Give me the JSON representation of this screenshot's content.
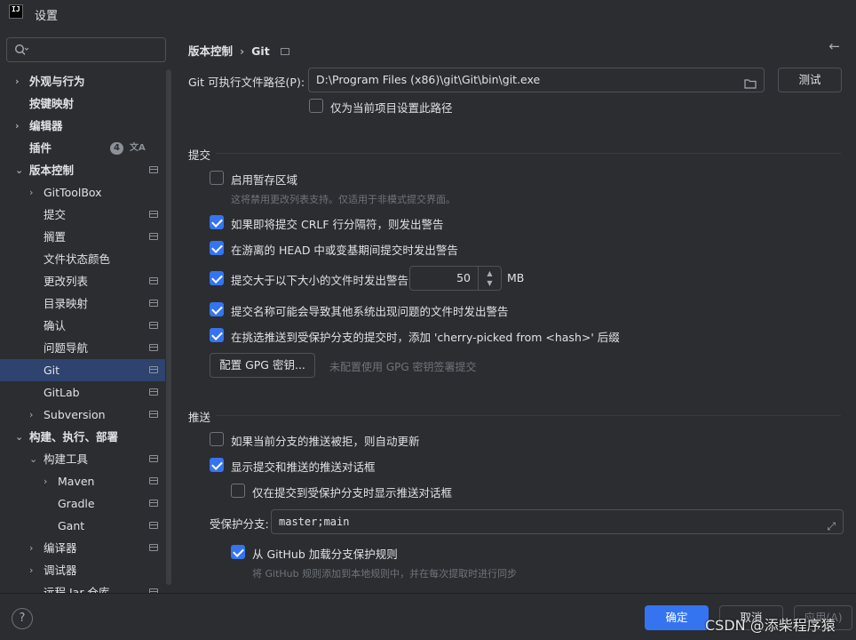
{
  "window": {
    "title": "设置",
    "logo_text": "IJ"
  },
  "search": {
    "placeholder": ""
  },
  "sidebar": {
    "items": [
      {
        "label": "外观与行为",
        "chevron": "›",
        "bold": true,
        "proj": false
      },
      {
        "label": "按键映射",
        "chevron": "",
        "bold": true,
        "proj": false
      },
      {
        "label": "编辑器",
        "chevron": "›",
        "bold": true,
        "proj": false
      },
      {
        "label": "插件",
        "chevron": "",
        "bold": true,
        "proj": false,
        "badge": "4"
      },
      {
        "label": "版本控制",
        "chevron": "⌄",
        "bold": true,
        "proj": true
      },
      {
        "label": "GitToolBox",
        "chevron": "›",
        "bold": false,
        "proj": false
      },
      {
        "label": "提交",
        "chevron": "",
        "bold": false,
        "proj": true
      },
      {
        "label": "搁置",
        "chevron": "",
        "bold": false,
        "proj": true
      },
      {
        "label": "文件状态颜色",
        "chevron": "",
        "bold": false,
        "proj": false
      },
      {
        "label": "更改列表",
        "chevron": "",
        "bold": false,
        "proj": true
      },
      {
        "label": "目录映射",
        "chevron": "",
        "bold": false,
        "proj": true
      },
      {
        "label": "确认",
        "chevron": "",
        "bold": false,
        "proj": true
      },
      {
        "label": "问题导航",
        "chevron": "",
        "bold": false,
        "proj": true
      },
      {
        "label": "Git",
        "chevron": "",
        "bold": false,
        "proj": true,
        "selected": true
      },
      {
        "label": "GitLab",
        "chevron": "",
        "bold": false,
        "proj": true
      },
      {
        "label": "Subversion",
        "chevron": "›",
        "bold": false,
        "proj": true
      },
      {
        "label": "构建、执行、部署",
        "chevron": "⌄",
        "bold": true,
        "proj": false
      },
      {
        "label": "构建工具",
        "chevron": "⌄",
        "bold": false,
        "proj": true
      },
      {
        "label": "Maven",
        "chevron": "›",
        "bold": false,
        "proj": true
      },
      {
        "label": "Gradle",
        "chevron": "",
        "bold": false,
        "proj": true
      },
      {
        "label": "Gant",
        "chevron": "",
        "bold": false,
        "proj": true
      },
      {
        "label": "编译器",
        "chevron": "›",
        "bold": false,
        "proj": true
      },
      {
        "label": "调试器",
        "chevron": "›",
        "bold": false,
        "proj": false
      },
      {
        "label": "远程 Jar 仓库",
        "chevron": "",
        "bold": false,
        "proj": true
      }
    ]
  },
  "breadcrumb": {
    "parent": "版本控制",
    "separator": "›",
    "current": "Git"
  },
  "git_path": {
    "label": "Git 可执行文件路径(P):",
    "value": "D:\\Program Files (x86)\\git\\Git\\bin\\git.exe",
    "test_button": "测试",
    "project_only_label": "仅为当前项目设置此路径",
    "project_only_checked": false
  },
  "commit": {
    "title": "提交",
    "staging_label": "启用暂存区域",
    "staging_checked": false,
    "staging_hint": "这将禁用更改列表支持。仅适用于非模式提交界面。",
    "crlf_label": "如果即将提交 CRLF 行分隔符，则发出警告",
    "crlf_checked": true,
    "detached_label": "在游离的 HEAD 中或变基期间提交时发出警告",
    "detached_checked": true,
    "size_label": "提交大于以下大小的文件时发出警告:",
    "size_checked": true,
    "size_value": "50",
    "size_unit": "MB",
    "filename_label": "提交名称可能会导致其他系统出现问题的文件时发出警告",
    "filename_checked": true,
    "cherry_label": "在挑选推送到受保护分支的提交时，添加 'cherry-picked from <hash>' 后缀",
    "cherry_checked": true,
    "gpg_button": "配置 GPG 密钥...",
    "gpg_hint": "未配置使用 GPG 密钥签署提交"
  },
  "push": {
    "title": "推送",
    "auto_update_label": "如果当前分支的推送被拒，则自动更新",
    "auto_update_checked": false,
    "show_dialog_label": "显示提交和推送的推送对话框",
    "show_dialog_checked": true,
    "protected_only_label": "仅在提交到受保护分支时显示推送对话框",
    "protected_only_checked": false,
    "protected_branches_label": "受保护分支:",
    "protected_branches_value": "master;main",
    "github_rules_label": "从 GitHub 加载分支保护规则",
    "github_rules_checked": true,
    "github_rules_hint": "将 GitHub 规则添加到本地规则中，并在每次提取时进行同步"
  },
  "footer": {
    "help": "?",
    "ok": "确定",
    "cancel": "取消",
    "apply": "应用(A)",
    "watermark": "CSDN @添柴程序猿"
  },
  "colors": {
    "accent": "#3574f0",
    "selection": "#2e436e",
    "background": "#2b2d30"
  }
}
